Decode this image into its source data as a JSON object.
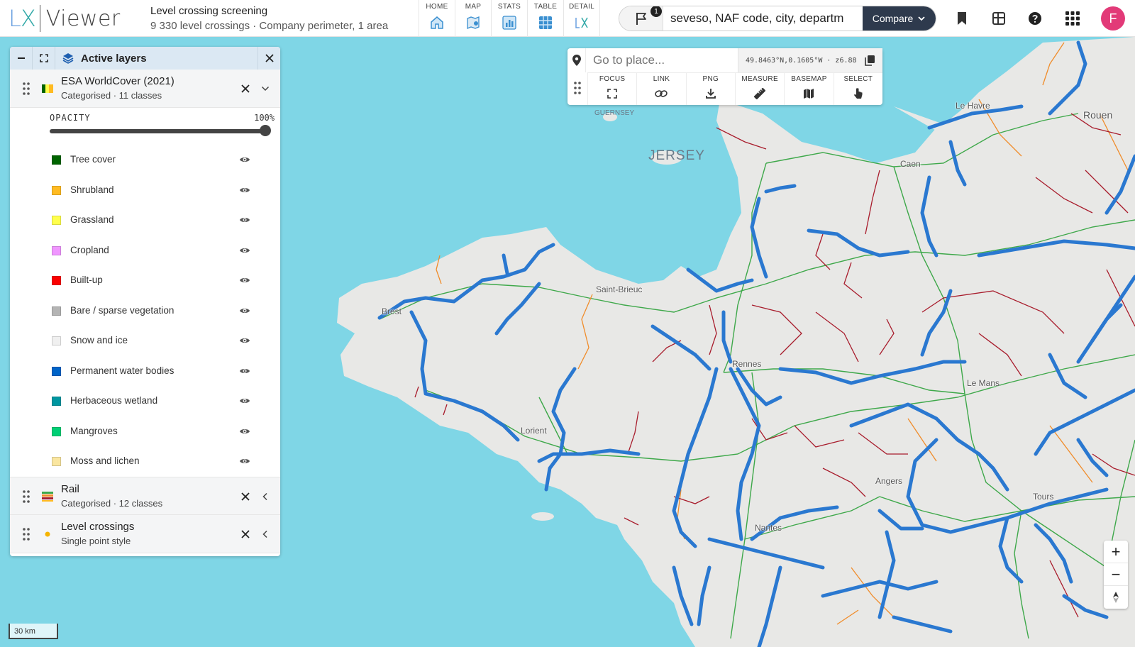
{
  "header": {
    "logo_lx_l": "L",
    "logo_lx_x": "X",
    "logo_name": "Viewer",
    "title": "Level crossing screening",
    "subtitle": "9 330 level crossings · Company perimeter, 1 area",
    "tabs": [
      {
        "label": "HOME",
        "icon": "home-icon"
      },
      {
        "label": "MAP",
        "icon": "map-icon"
      },
      {
        "label": "STATS",
        "icon": "stats-icon"
      },
      {
        "label": "TABLE",
        "icon": "table-icon"
      },
      {
        "label": "DETAIL",
        "icon": "lx-detail-icon"
      }
    ],
    "notification_count": "1",
    "search_value": "seveso, NAF code, city, departm",
    "compare_label": "Compare",
    "avatar_initial": "F"
  },
  "panel": {
    "title": "Active layers",
    "layers": [
      {
        "name": "ESA WorldCover (2021)",
        "subtitle": "Categorised · 11 classes",
        "expanded": true
      },
      {
        "name": "Rail",
        "subtitle": "Categorised · 12 classes",
        "expanded": false
      },
      {
        "name": "Level crossings",
        "subtitle": "Single point style",
        "expanded": false
      }
    ],
    "opacity_label": "OPACITY",
    "opacity_value": "100%",
    "opacity_fraction": 1.0,
    "legend": [
      {
        "label": "Tree cover",
        "color": "#006400"
      },
      {
        "label": "Shrubland",
        "color": "#ffbb22"
      },
      {
        "label": "Grassland",
        "color": "#ffff4c"
      },
      {
        "label": "Cropland",
        "color": "#f096ff"
      },
      {
        "label": "Built-up",
        "color": "#fa0000"
      },
      {
        "label": "Bare / sparse vegetation",
        "color": "#b4b4b4"
      },
      {
        "label": "Snow and ice",
        "color": "#f0f0f0"
      },
      {
        "label": "Permanent water bodies",
        "color": "#0064c8"
      },
      {
        "label": "Herbaceous wetland",
        "color": "#0096a0"
      },
      {
        "label": "Mangroves",
        "color": "#00cf75"
      },
      {
        "label": "Moss and lichen",
        "color": "#fae6a0"
      }
    ]
  },
  "tools": {
    "place_placeholder": "Go to place...",
    "coords": "49.8463°N,0.1605°W · z6.88",
    "buttons": [
      {
        "label": "FOCUS",
        "icon": "focus-icon"
      },
      {
        "label": "LINK",
        "icon": "link-icon"
      },
      {
        "label": "PNG",
        "icon": "download-icon"
      },
      {
        "label": "MEASURE",
        "icon": "ruler-icon"
      },
      {
        "label": "BASEMAP",
        "icon": "basemap-icon"
      },
      {
        "label": "SELECT",
        "icon": "pointer-icon"
      }
    ]
  },
  "map": {
    "labels": {
      "guernsey": "GUERNSEY",
      "jersey": "JERSEY",
      "le_havre": "Le Havre",
      "rouen": "Rouen",
      "caen": "Caen",
      "saint_brieuc": "Saint-Brieuc",
      "brest": "Brest",
      "rennes": "Rennes",
      "le_mans": "Le Mans",
      "lorient": "Lorient",
      "angers": "Angers",
      "tours": "Tours",
      "nantes": "Nantes"
    },
    "scale_label": "30 km",
    "colors": {
      "sea": "#7fd6e6",
      "land": "#e8e8e6",
      "rail_main": "#3ea84a",
      "rail_secondary": "#f08c2a",
      "rail_local": "#a81c2c",
      "crossings": "#2a78d0"
    }
  }
}
